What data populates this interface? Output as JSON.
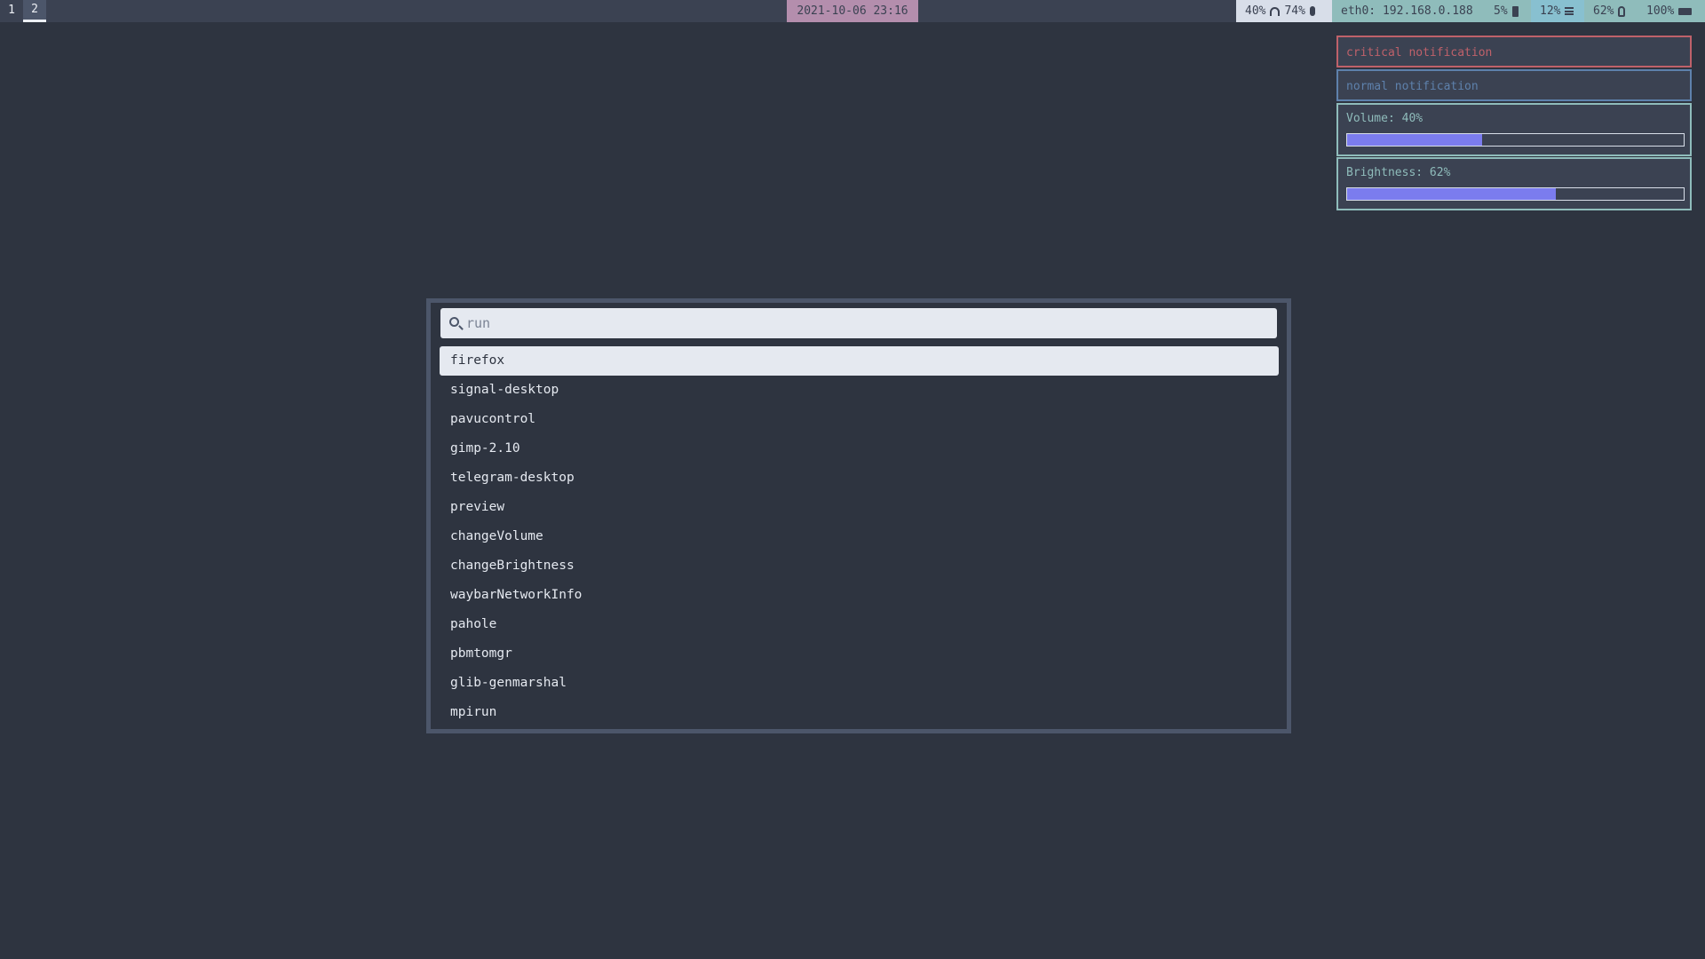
{
  "workspaces": [
    {
      "label": "1",
      "active": false
    },
    {
      "label": "2",
      "active": true
    }
  ],
  "clock": "2021-10-06 23:16",
  "modules": {
    "audio": {
      "volume": "40%",
      "volume_icon": "headphones-icon",
      "mic": "74%",
      "mic_icon": "microphone-icon"
    },
    "network": {
      "text": "eth0: 192.168.0.188"
    },
    "cpu": {
      "text": "5%",
      "icon": "cpu-icon"
    },
    "memory": {
      "text": "12%",
      "icon": "memory-icon"
    },
    "brightness": {
      "text": "62%",
      "icon": "lightbulb-icon"
    },
    "battery": {
      "text": "100%",
      "icon": "battery-icon"
    }
  },
  "notifications": {
    "critical": "critical notification",
    "normal": "normal notification",
    "volume": {
      "label": "Volume: 40%",
      "level": 0.4
    },
    "brightness": {
      "label": "Brightness: 62%",
      "level": 0.62
    }
  },
  "launcher": {
    "search": {
      "value": "",
      "placeholder": "run"
    },
    "selected_index": 0,
    "items": [
      "firefox",
      "signal-desktop",
      "pavucontrol",
      "gimp-2.10",
      "telegram-desktop",
      "preview",
      "changeVolume",
      "changeBrightness",
      "waybarNetworkInfo",
      "pahole",
      "pbmtomgr",
      "glib-genmarshal",
      "mpirun"
    ]
  },
  "colors": {
    "background": "#2e3440",
    "bar": "#3b4252",
    "critical": "#bf616a",
    "normal": "#5e81ac",
    "accent": "#8fbcbb",
    "progress_fill": "#7b7cee",
    "clock": "#b48ead"
  }
}
